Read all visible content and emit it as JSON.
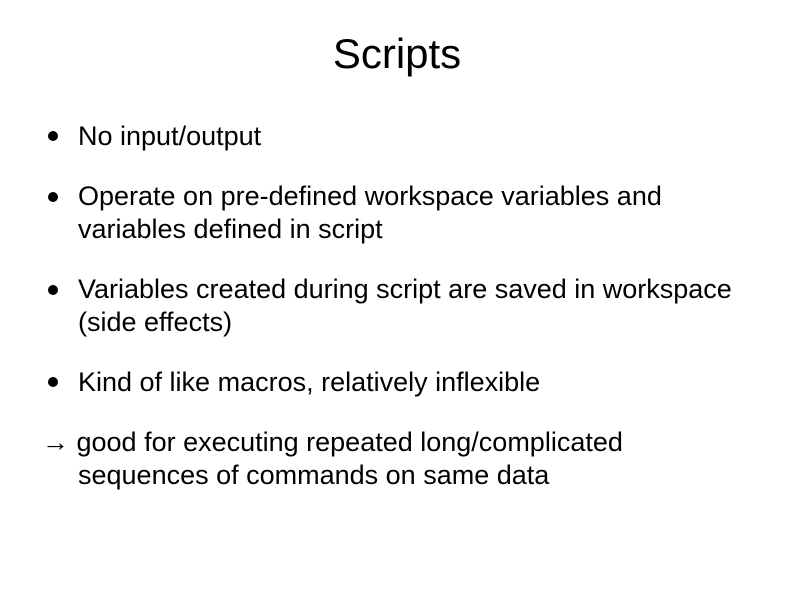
{
  "title": "Scripts",
  "bullets": [
    "No input/output",
    "Operate on pre-defined workspace variables and variables defined in script",
    "Variables created during script are saved in workspace (side effects)",
    "Kind of like macros, relatively inflexible"
  ],
  "conclusion": "→ good for executing repeated long/complicated sequences of commands on same data"
}
